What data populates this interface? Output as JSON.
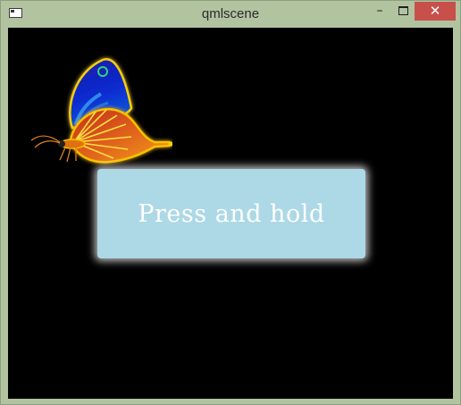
{
  "window": {
    "title": "qmlscene",
    "controls": {
      "minimize": "–",
      "close": "✕"
    }
  },
  "main": {
    "button_label": "Press and hold",
    "button_color": "#add8e6",
    "background_color": "#000000"
  },
  "icons": {
    "app": "app-window-icon",
    "butterfly": "butterfly-image"
  }
}
